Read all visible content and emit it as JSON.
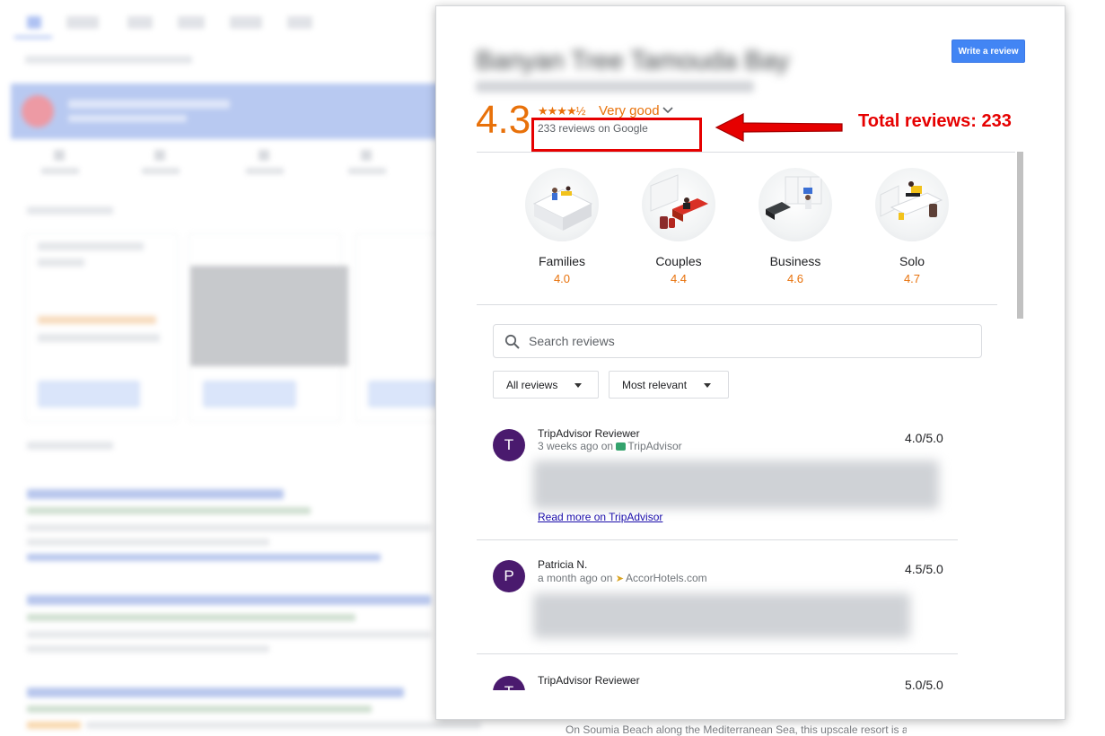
{
  "modal": {
    "hotel_name": "Banyan Tree Tamouda Bay",
    "write_review_label": "Write a review",
    "overall_rating": "4.3",
    "stars": "★★★★½",
    "rating_text": "Very good",
    "reviews_count_text": "233 reviews on Google",
    "traveller_types": [
      {
        "name": "Families",
        "score": "4.0"
      },
      {
        "name": "Couples",
        "score": "4.4"
      },
      {
        "name": "Business",
        "score": "4.6"
      },
      {
        "name": "Solo",
        "score": "4.7"
      }
    ],
    "search": {
      "placeholder": "Search reviews"
    },
    "filters": {
      "all_reviews_label": "All reviews",
      "sort_label": "Most relevant"
    },
    "reviews": [
      {
        "initial": "T",
        "name": "TripAdvisor Reviewer",
        "time": "3 weeks ago on",
        "source": "TripAdvisor",
        "score": "4.0/5.0",
        "link": "Read more on TripAdvisor"
      },
      {
        "initial": "P",
        "name": "Patricia N.",
        "time": "a month ago on",
        "source": "AccorHotels.com",
        "score": "4.5/5.0"
      },
      {
        "initial": "T",
        "name": "TripAdvisor Reviewer",
        "score": "5.0/5.0"
      }
    ]
  },
  "annotation": {
    "text": "Total reviews: 233",
    "color": "#e60000"
  },
  "background": {
    "footer_snippet": "On Soumia Beach along the Mediterranean Sea, this upscale resort is a"
  },
  "colors": {
    "accent_orange": "#e8710a",
    "button_blue": "#4285f4",
    "avatar_purple": "#4a1a6e"
  }
}
